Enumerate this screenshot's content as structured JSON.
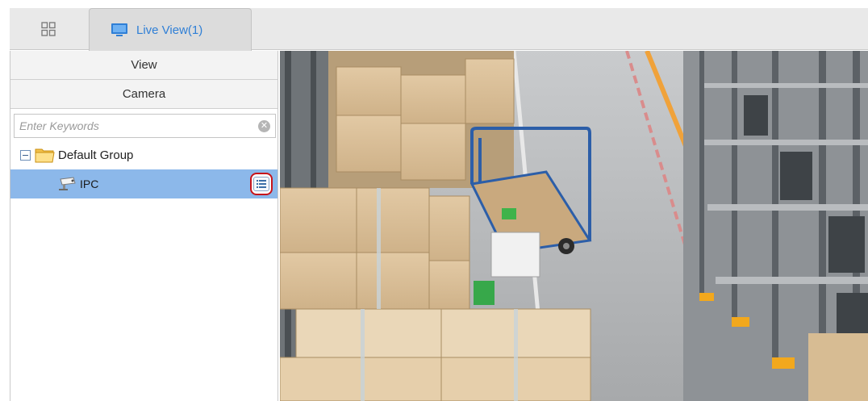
{
  "tabs": {
    "live_view_label": "Live View(1)"
  },
  "left_panel": {
    "view_header": "View",
    "camera_header": "Camera",
    "search": {
      "placeholder": "Enter Keywords",
      "value": ""
    },
    "tree": {
      "group_label": "Default Group",
      "items": [
        {
          "label": "IPC"
        }
      ]
    }
  },
  "icons": {
    "home_tab": "grid-icon",
    "live_tab": "monitor-icon",
    "clear": "clear-icon",
    "tree_toggle": "collapse-icon",
    "group": "folder-icon",
    "device": "camera-icon",
    "item_menu": "list-icon"
  },
  "colors": {
    "accent": "#2f7fd6",
    "selected_row": "#8cb8ea",
    "highlight_ring": "#c7141b"
  }
}
